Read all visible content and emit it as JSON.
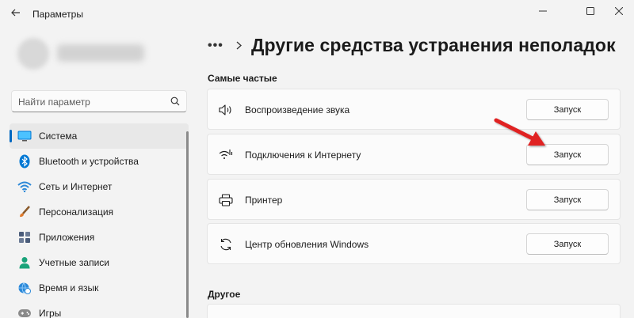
{
  "window": {
    "title": "Параметры",
    "controls": [
      "minimize",
      "maximize",
      "close"
    ]
  },
  "search": {
    "placeholder": "Найти параметр"
  },
  "sidebar": {
    "items": [
      {
        "label": "Система",
        "icon": "system-icon",
        "active": true,
        "color": "#0078d4"
      },
      {
        "label": "Bluetooth и устройства",
        "icon": "bluetooth-icon",
        "active": false,
        "color": "#0078d4"
      },
      {
        "label": "Сеть и Интернет",
        "icon": "wifi-icon",
        "active": false,
        "color": "#2b88d8"
      },
      {
        "label": "Персонализация",
        "icon": "brush-icon",
        "active": false,
        "color": "#c47a2c"
      },
      {
        "label": "Приложения",
        "icon": "apps-icon",
        "active": false,
        "color": "#4a5c7a"
      },
      {
        "label": "Учетные записи",
        "icon": "person-icon",
        "active": false,
        "color": "#1aa37a"
      },
      {
        "label": "Время и язык",
        "icon": "globe-clock-icon",
        "active": false,
        "color": "#2b88d8"
      },
      {
        "label": "Игры",
        "icon": "gamepad-icon",
        "active": false,
        "color": "#777777"
      }
    ]
  },
  "main": {
    "breadcrumb_more": "•••",
    "title": "Другие средства устранения неполадок",
    "sections": {
      "frequent": "Самые частые",
      "other": "Другое"
    },
    "cards": [
      {
        "label": "Воспроизведение звука",
        "icon": "speaker-icon",
        "button": "Запуск"
      },
      {
        "label": "Подключения к Интернету",
        "icon": "wifi-signal-icon",
        "button": "Запуск"
      },
      {
        "label": "Принтер",
        "icon": "printer-icon",
        "button": "Запуск"
      },
      {
        "label": "Центр обновления Windows",
        "icon": "sync-icon",
        "button": "Запуск"
      }
    ]
  },
  "colors": {
    "accent": "#0067c0",
    "annotation_arrow": "#e02020"
  }
}
